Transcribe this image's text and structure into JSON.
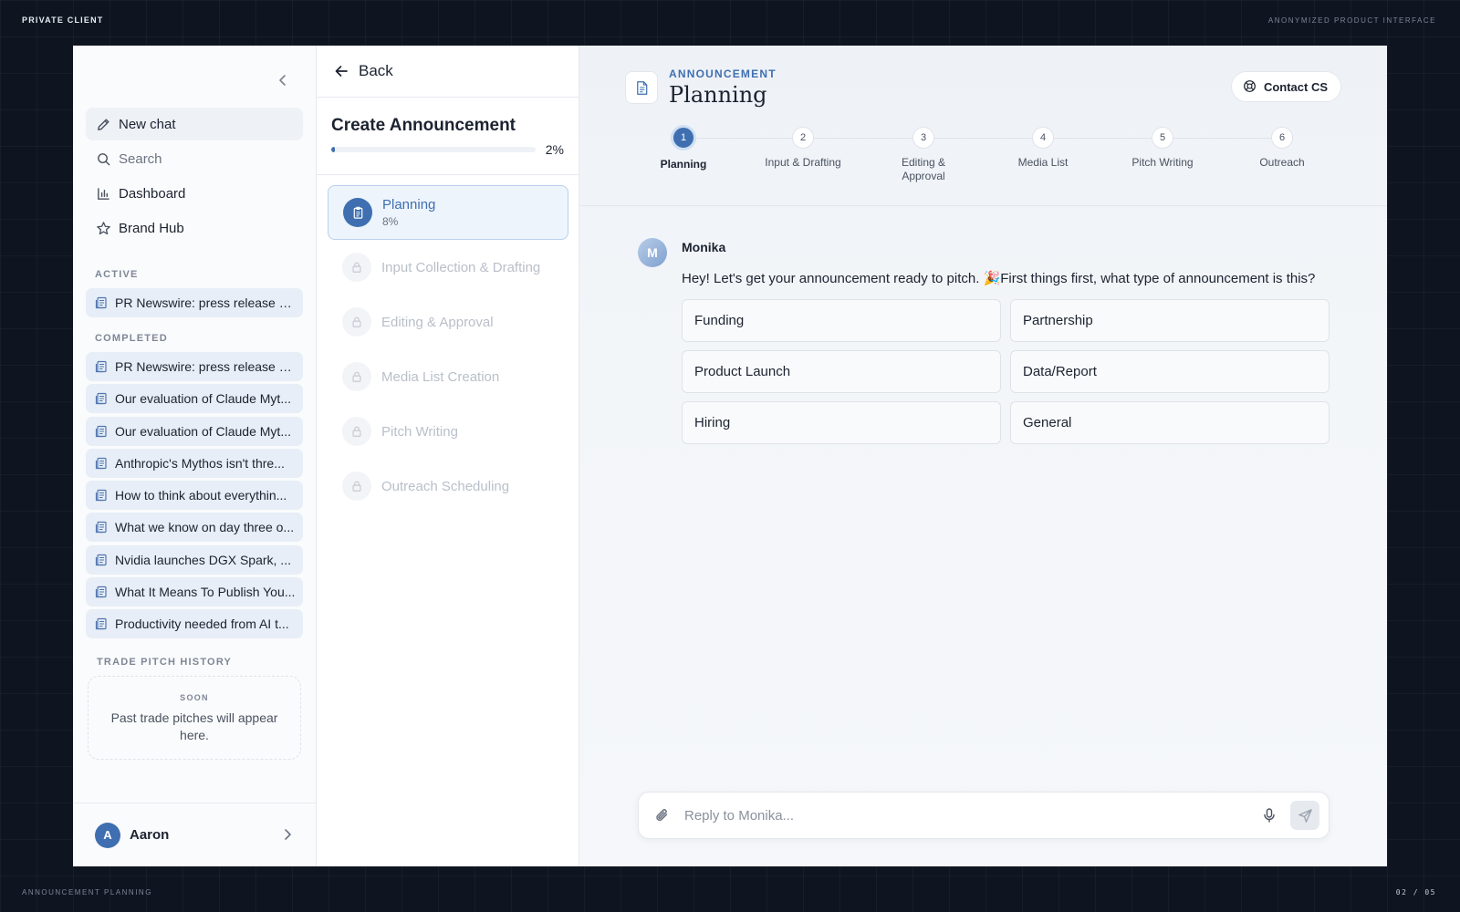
{
  "frame": {
    "top_left": "PRIVATE CLIENT",
    "top_right": "ANONYMIZED PRODUCT INTERFACE",
    "bottom_left": "ANNOUNCEMENT PLANNING",
    "bottom_right": "02 / 05"
  },
  "sidebar": {
    "nav": [
      {
        "label": "New chat",
        "icon": "pencil-icon"
      },
      {
        "label": "Search",
        "icon": "search-icon"
      },
      {
        "label": "Dashboard",
        "icon": "bar-chart-icon"
      },
      {
        "label": "Brand Hub",
        "icon": "star-icon"
      }
    ],
    "active_title": "ACTIVE",
    "active_chats": [
      "PR Newswire: press release d..."
    ],
    "completed_title": "COMPLETED",
    "completed_chats": [
      "PR Newswire: press release d...",
      "Our evaluation of Claude Myt...",
      "Our evaluation of Claude Myt...",
      "Anthropic's Mythos isn't thre...",
      "How to think about everythin...",
      "What we know on day three o...",
      "Nvidia launches DGX Spark, ...",
      "What It Means To Publish You...",
      "Productivity needed from AI t..."
    ],
    "trade_title": "TRADE PITCH HISTORY",
    "soon_label": "SOON",
    "soon_message": "Past trade pitches will appear here.",
    "user": {
      "initial": "A",
      "name": "Aaron"
    }
  },
  "steps_panel": {
    "back_label": "Back",
    "title": "Create Announcement",
    "progress_pct": "2%",
    "progress_value": 0.02,
    "steps": [
      {
        "label": "Planning",
        "sub": "8%",
        "state": "current"
      },
      {
        "label": "Input Collection & Drafting",
        "state": "locked"
      },
      {
        "label": "Editing & Approval",
        "state": "locked"
      },
      {
        "label": "Media List Creation",
        "state": "locked"
      },
      {
        "label": "Pitch Writing",
        "state": "locked"
      },
      {
        "label": "Outreach Scheduling",
        "state": "locked"
      }
    ]
  },
  "main": {
    "kicker": "ANNOUNCEMENT",
    "title": "Planning",
    "contact_label": "Contact CS",
    "stepper": [
      {
        "num": "1",
        "label": "Planning"
      },
      {
        "num": "2",
        "label": "Input & Drafting"
      },
      {
        "num": "3",
        "label": "Editing & Approval"
      },
      {
        "num": "4",
        "label": "Media List"
      },
      {
        "num": "5",
        "label": "Pitch Writing"
      },
      {
        "num": "6",
        "label": "Outreach"
      }
    ],
    "message": {
      "avatar_initial": "M",
      "author": "Monika",
      "text": "Hey! Let's get your announcement ready to pitch. 🎉First things first, what type of announcement is this?"
    },
    "options": [
      "Funding",
      "Partnership",
      "Product Launch",
      "Data/Report",
      "Hiring",
      "General"
    ],
    "composer_placeholder": "Reply to Monika..."
  },
  "colors": {
    "accent": "#3f6fb0",
    "background": "#0f1520"
  }
}
